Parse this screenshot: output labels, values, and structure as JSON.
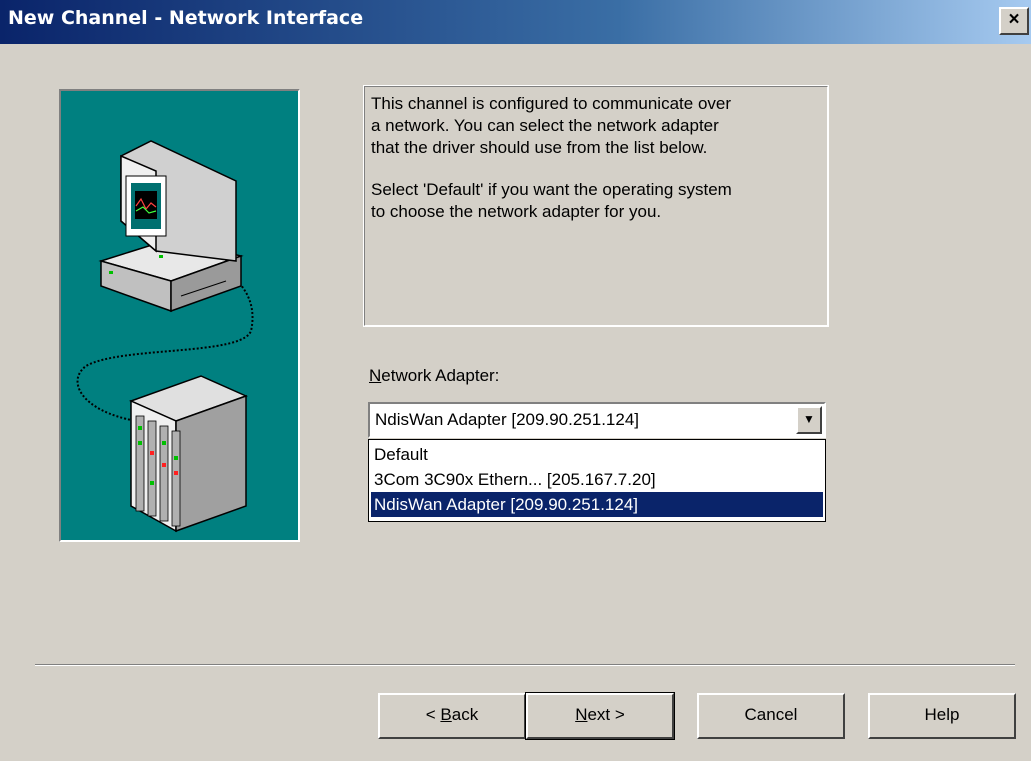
{
  "window": {
    "title": "New Channel - Network Interface",
    "close_label": "×"
  },
  "illustration": {
    "background": "#008080",
    "icons": [
      "computer-monitor-icon",
      "network-cable-icon",
      "server-rack-icon"
    ]
  },
  "info": {
    "paragraph1": "This channel is configured to communicate over\na network.  You can select the network adapter\nthat the driver should use from the list below.",
    "paragraph2": "Select 'Default' if you want the operating system\nto choose the network adapter for you."
  },
  "adapter": {
    "label_mnemonic": "N",
    "label_rest": "etwork Adapter:",
    "selected": "NdisWan Adapter [209.90.251.124]",
    "options": [
      "Default",
      "3Com 3C90x Ethern... [205.167.7.20]",
      "NdisWan Adapter [209.90.251.124]"
    ],
    "selected_index": 2
  },
  "buttons": {
    "back_mnemonic": "B",
    "back_prefix": "< ",
    "back_rest": "ack",
    "next_mnemonic": "N",
    "next_rest": "ext >",
    "cancel": "Cancel",
    "help": "Help"
  },
  "colors": {
    "selection": "#0a246a",
    "face": "#d4d0c8",
    "title_start": "#0a246a"
  }
}
